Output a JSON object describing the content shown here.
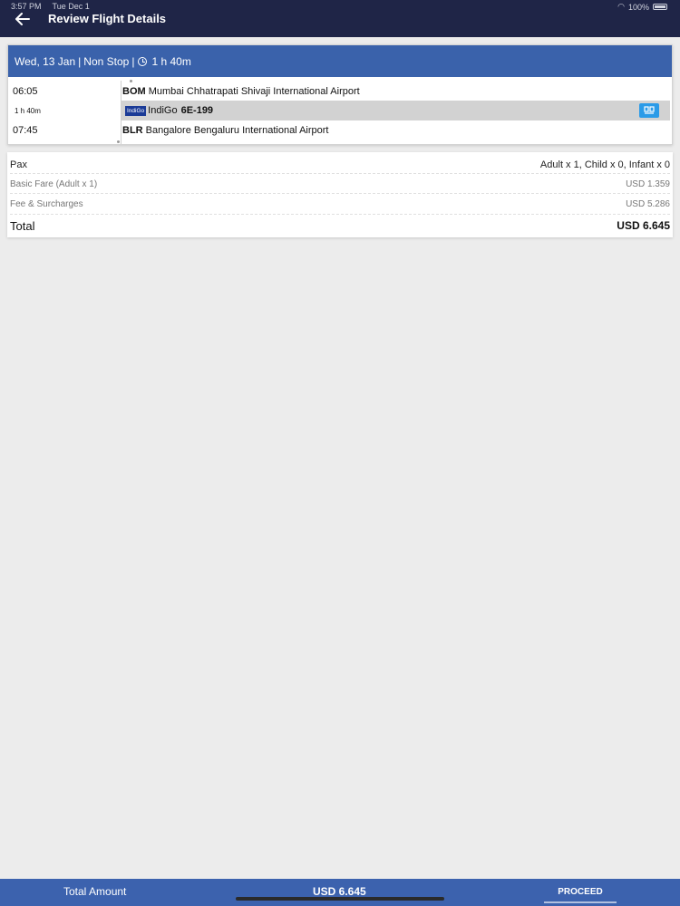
{
  "status_bar": {
    "time": "3:57 PM",
    "date": "Tue Dec 1",
    "battery": "100%"
  },
  "header": {
    "title": "Review Flight Details",
    "back_icon": "arrow-left-icon"
  },
  "flight": {
    "date": "Wed, 13 Jan",
    "stops": "Non Stop",
    "duration_header": "1 h 40m",
    "departure_time": "06:05",
    "duration": "1 h 40m",
    "arrival_time": "07:45",
    "departure_code": "BOM",
    "departure_airport": "Mumbai Chhatrapati Shivaji International Airport",
    "airline_logo_text": "IndiGo",
    "airline_name": "IndiGo",
    "flight_number": "6E-199",
    "arrival_code": "BLR",
    "arrival_airport": "Bangalore Bengaluru International Airport"
  },
  "fare": {
    "pax_label": "Pax",
    "pax_value": "Adult x 1, Child x 0, Infant x 0",
    "basic_label": "Basic Fare (Adult x 1)",
    "basic_value": "USD 1.359",
    "fee_label": "Fee & Surcharges",
    "fee_value": "USD 5.286",
    "total_label": "Total",
    "total_value": "USD 6.645"
  },
  "footer": {
    "total_label": "Total Amount",
    "total_value": "USD 6.645",
    "proceed_label": "PROCEED"
  },
  "colors": {
    "header_bg": "#1f2547",
    "accent_blue": "#3a62ab",
    "seat_button": "#2b9be8"
  }
}
